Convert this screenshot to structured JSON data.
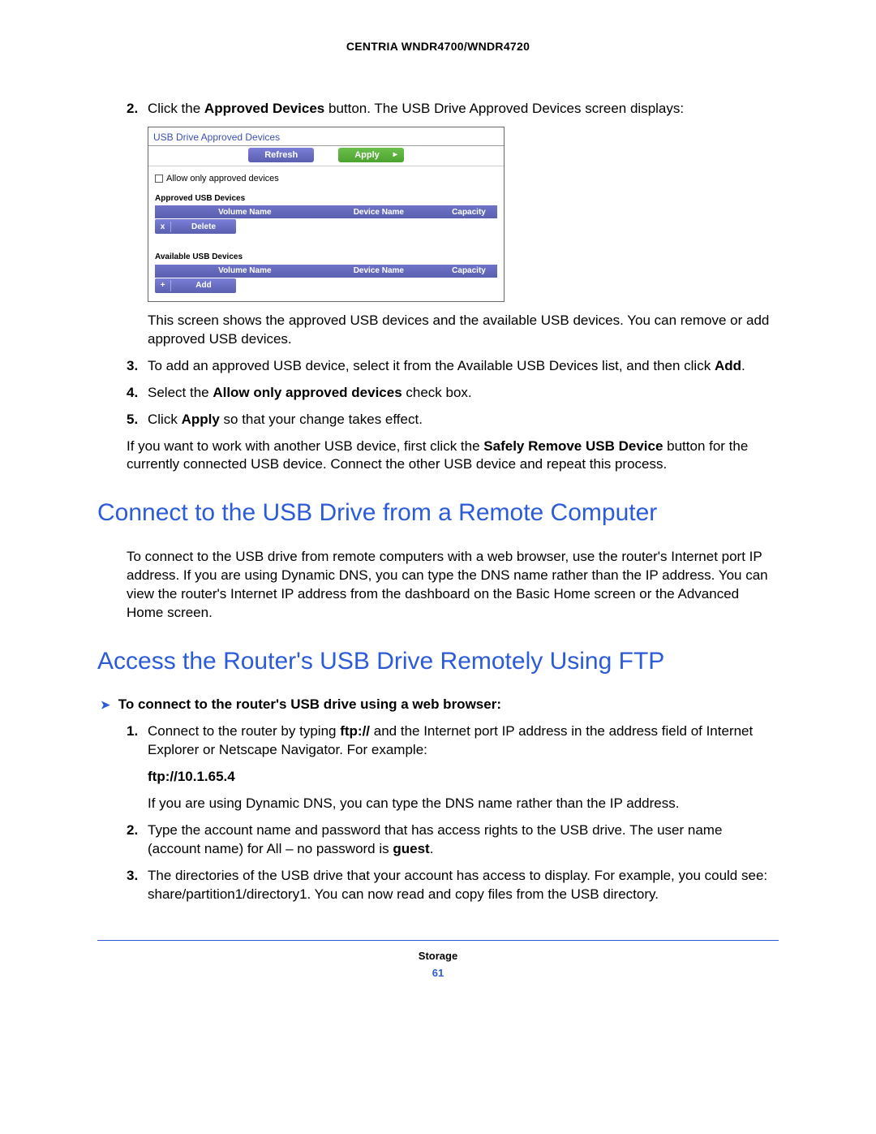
{
  "header": {
    "product": "CENTRIA WNDR4700/WNDR4720"
  },
  "steps_a": {
    "n2": "2.",
    "n3": "3.",
    "n4": "4.",
    "n5": "5.",
    "s2_pre": "Click the ",
    "s2_b": "Approved Devices",
    "s2_post": " button. The USB Drive Approved Devices screen displays:",
    "s2_after": "This screen shows the approved USB devices and the available USB devices. You can remove or add approved USB devices.",
    "s3_text": "To add an approved USB device, select it from the Available USB Devices list, and then click ",
    "s3_b": "Add",
    "s3_post": ".",
    "s4_pre": "Select the ",
    "s4_b": "Allow only approved devices",
    "s4_post": " check box.",
    "s5_pre": "Click ",
    "s5_b": "Apply",
    "s5_post": " so that your change takes effect.",
    "note_pre": "If you want to work with another USB device, first click the ",
    "note_b": "Safely Remove USB Device",
    "note_post": " button for the currently connected USB device. Connect the other USB device and repeat this process."
  },
  "screenshot": {
    "title": "USB Drive Approved Devices",
    "refresh": "Refresh",
    "apply": "Apply",
    "checkbox_label": "Allow only approved devices",
    "section_approved": "Approved USB Devices",
    "section_available": "Available USB Devices",
    "col_volume": "Volume Name",
    "col_device": "Device Name",
    "col_capacity": "Capacity",
    "btn_delete_glyph": "x",
    "btn_delete": "Delete",
    "btn_add_glyph": "+",
    "btn_add": "Add"
  },
  "h2_connect": "Connect to the USB Drive from a Remote Computer",
  "p_connect": "To connect to the USB drive from remote computers with a web browser, use the router's Internet port IP address. If you are using Dynamic DNS, you can type the DNS name rather than the IP address. You can view the router's Internet IP address from the dashboard on the Basic Home screen or the Advanced Home screen.",
  "h2_ftp": "Access the Router's USB Drive Remotely Using FTP",
  "task_arrow": "➤",
  "task_label": "To connect to the router's USB drive using a web browser:",
  "steps_b": {
    "n1": "1.",
    "n2": "2.",
    "n3": "3.",
    "s1_pre": "Connect to the router by typing ",
    "s1_b": "ftp://",
    "s1_post": " and the Internet port IP address in the address field of Internet Explorer or Netscape Navigator. For example:",
    "ftp_example": "ftp://10.1.65.4",
    "s1_after": "If you are using Dynamic DNS, you can type the DNS name rather than the IP address.",
    "s2_pre": "Type the account name and password that has access rights to the USB drive. The user name (account name) for All – no password is ",
    "s2_b": "guest",
    "s2_post": ".",
    "s3": "The directories of the USB drive that your account has access to display. For example, you could see: share/partition1/directory1. You can now read and copy files from the USB directory."
  },
  "footer": {
    "category": "Storage",
    "page": "61"
  }
}
